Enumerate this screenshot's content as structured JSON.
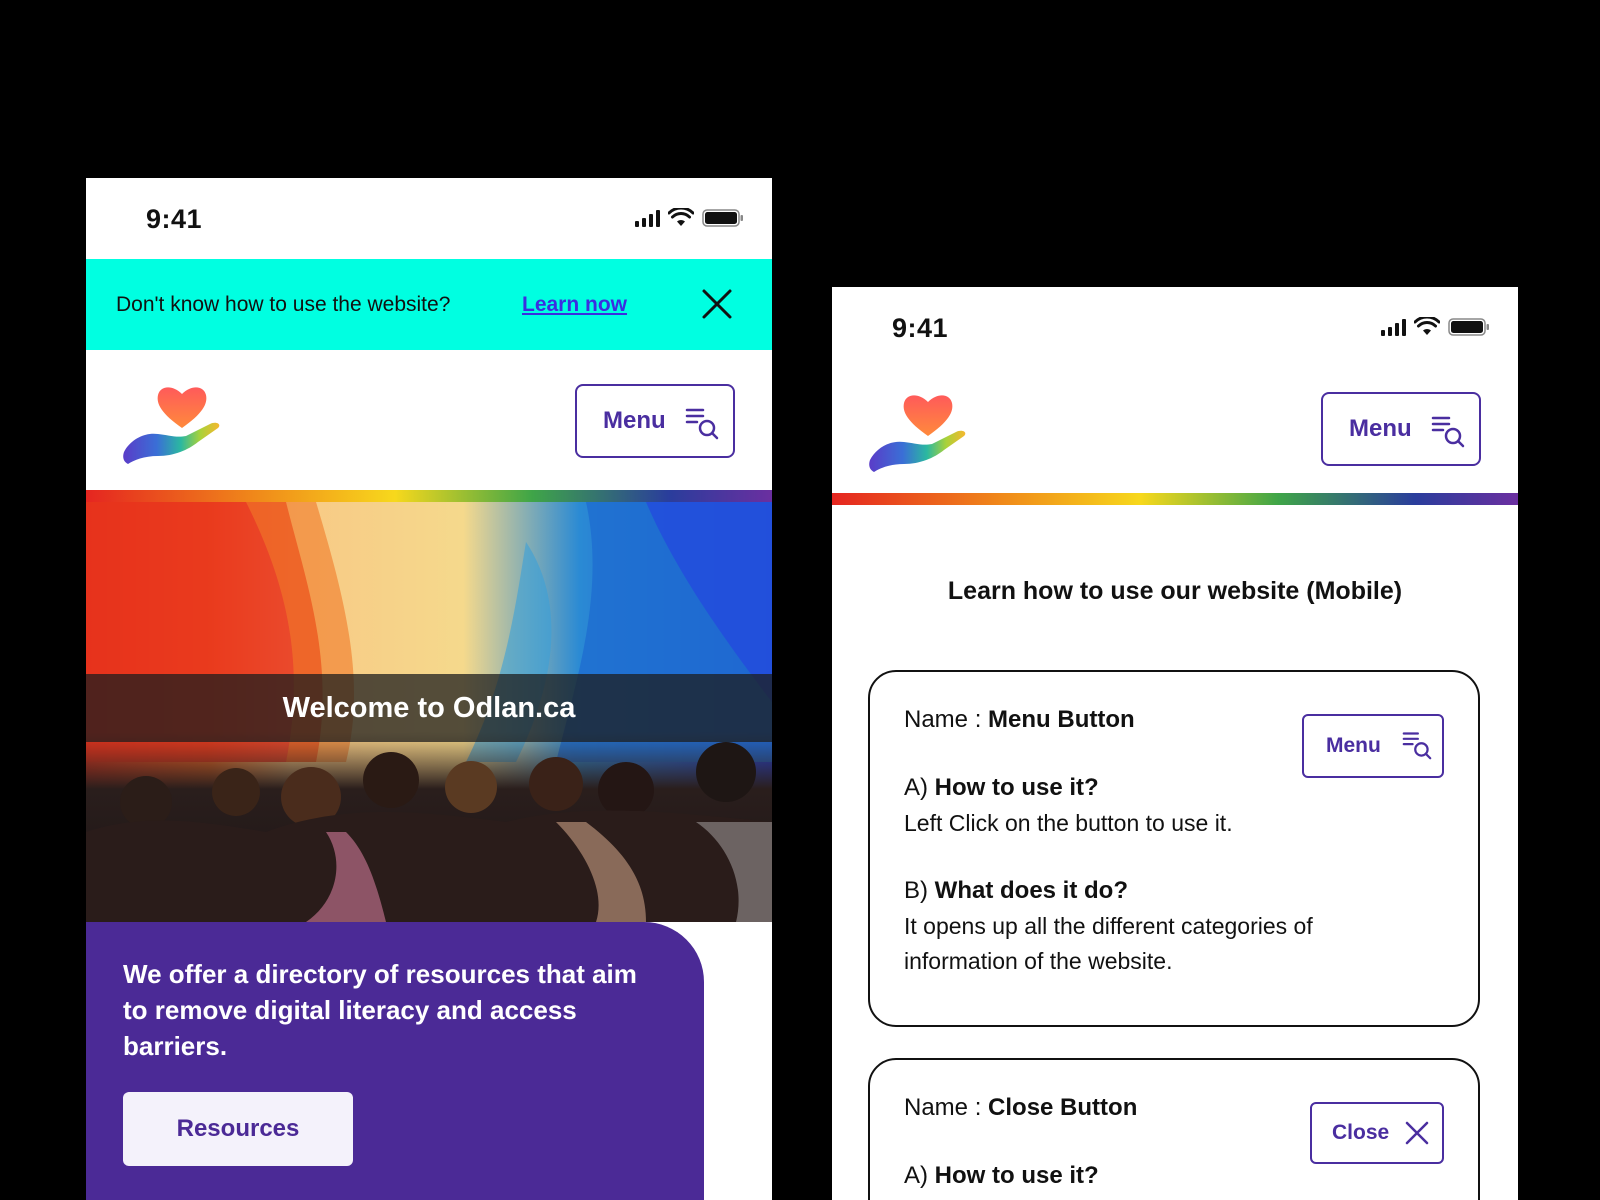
{
  "colors": {
    "accent": "#4b2a96",
    "banner": "#00FFE1",
    "link": "#3b2ee0"
  },
  "left_phone": {
    "status": {
      "time": "9:41"
    },
    "banner": {
      "text": "Don't know how to use the website?",
      "link": "Learn now"
    },
    "header": {
      "menu_label": "Menu"
    },
    "hero": {
      "caption": "Welcome to Odlan.ca"
    },
    "intro": {
      "text": "We offer a directory of resources that aim to remove digital literacy and access barriers.",
      "button": "Resources"
    }
  },
  "right_phone": {
    "status": {
      "time": "9:41"
    },
    "header": {
      "menu_label": "Menu"
    },
    "title": "Learn how to use our website (Mobile)",
    "cards": [
      {
        "name_label": "Name :",
        "name_value": "Menu Button",
        "demo_button": "Menu",
        "a_label": "A)",
        "a_heading": "How to use it?",
        "a_text": "Left Click on the button to use it.",
        "b_label": "B)",
        "b_heading": "What does it do?",
        "b_text": "It opens up all the different categories of information of the website."
      },
      {
        "name_label": "Name :",
        "name_value": "Close Button",
        "demo_button": "Close",
        "a_label": "A)",
        "a_heading": "How to use it?"
      }
    ]
  }
}
